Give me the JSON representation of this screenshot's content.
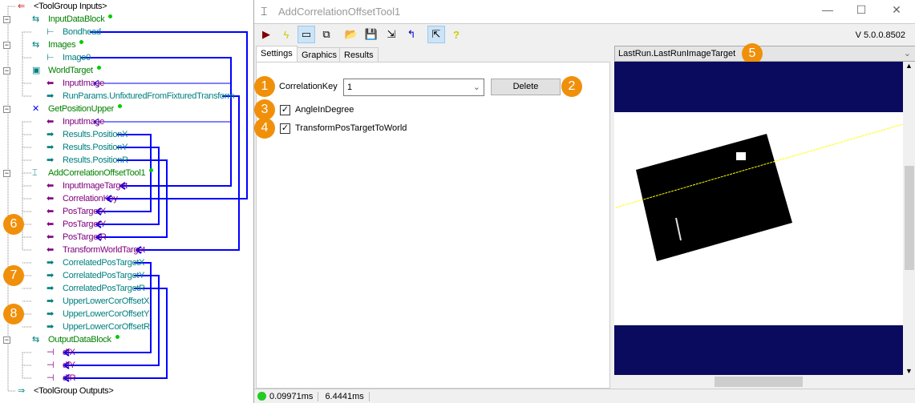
{
  "tree": {
    "rows": [
      {
        "label": "<ToolGroup Inputs>",
        "color": "black",
        "indent": 0,
        "icon": "toolgroup-inputs-icon"
      },
      {
        "label": "InputDataBlock",
        "color": "green",
        "indent": 1,
        "icon": "datablock-icon",
        "ok": true
      },
      {
        "label": "Bondhead",
        "color": "teal",
        "indent": 2,
        "icon": "output-terminal-icon"
      },
      {
        "label": "Images",
        "color": "green",
        "indent": 1,
        "icon": "datablock-icon",
        "ok": true
      },
      {
        "label": "Image0",
        "color": "teal",
        "indent": 2,
        "icon": "output-terminal-icon"
      },
      {
        "label": "WorldTarget",
        "color": "green",
        "indent": 1,
        "icon": "calib-tool-icon",
        "ok": true
      },
      {
        "label": "InputImage",
        "color": "purple",
        "indent": 2,
        "icon": "input-arrow-icon"
      },
      {
        "label": "RunParams.UnfixturedFromFixturedTransform",
        "color": "teal",
        "indent": 2,
        "icon": "output-arrow-icon"
      },
      {
        "label": "GetPositionUpper",
        "color": "green",
        "indent": 1,
        "icon": "position-tool-icon",
        "ok": true
      },
      {
        "label": "InputImage",
        "color": "purple",
        "indent": 2,
        "icon": "input-arrow-icon"
      },
      {
        "label": "Results.PositionX",
        "color": "teal",
        "indent": 2,
        "icon": "output-arrow-icon"
      },
      {
        "label": "Results.PositionY",
        "color": "teal",
        "indent": 2,
        "icon": "output-arrow-icon"
      },
      {
        "label": "Results.PositionR",
        "color": "teal",
        "indent": 2,
        "icon": "output-arrow-icon"
      },
      {
        "label": "AddCorrelationOffsetTool1",
        "color": "green",
        "indent": 1,
        "icon": "correlation-tool-icon",
        "ok": true
      },
      {
        "label": "InputImageTarget",
        "color": "purple",
        "indent": 2,
        "icon": "input-arrow-icon"
      },
      {
        "label": "CorrelationKey",
        "color": "purple",
        "indent": 2,
        "icon": "input-arrow-icon"
      },
      {
        "label": "PosTargetX",
        "color": "purple",
        "indent": 2,
        "icon": "input-arrow-icon"
      },
      {
        "label": "PosTargetY",
        "color": "purple",
        "indent": 2,
        "icon": "input-arrow-icon"
      },
      {
        "label": "PosTargetR",
        "color": "purple",
        "indent": 2,
        "icon": "input-arrow-icon"
      },
      {
        "label": "TransformWorldTarget",
        "color": "purple",
        "indent": 2,
        "icon": "input-arrow-icon"
      },
      {
        "label": "CorrelatedPosTargetX",
        "color": "teal",
        "indent": 2,
        "icon": "output-arrow-icon"
      },
      {
        "label": "CorrelatedPosTargetY",
        "color": "teal",
        "indent": 2,
        "icon": "output-arrow-icon"
      },
      {
        "label": "CorrelatedPosTargetR",
        "color": "teal",
        "indent": 2,
        "icon": "output-arrow-icon"
      },
      {
        "label": "UpperLowerCorOffsetX",
        "color": "teal",
        "indent": 2,
        "icon": "output-arrow-icon"
      },
      {
        "label": "UpperLowerCorOffsetY",
        "color": "teal",
        "indent": 2,
        "icon": "output-arrow-icon"
      },
      {
        "label": "UpperLowerCorOffsetR",
        "color": "teal",
        "indent": 2,
        "icon": "output-arrow-icon"
      },
      {
        "label": "OutputDataBlock",
        "color": "green",
        "indent": 1,
        "icon": "datablock-icon",
        "ok": true
      },
      {
        "label": "dfX",
        "color": "purple",
        "indent": 2,
        "icon": "input-terminal-icon"
      },
      {
        "label": "dfY",
        "color": "purple",
        "indent": 2,
        "icon": "input-terminal-icon"
      },
      {
        "label": "dfR",
        "color": "purple",
        "indent": 2,
        "icon": "input-terminal-icon"
      },
      {
        "label": "<ToolGroup Outputs>",
        "color": "black",
        "indent": 0,
        "icon": "toolgroup-outputs-icon"
      }
    ],
    "badges": [
      "6",
      "7",
      "8"
    ]
  },
  "window": {
    "title": "AddCorrelationOffsetTool1",
    "minimize": "—",
    "maximize": "☐",
    "close": "✕",
    "version": "V 5.0.0.8502",
    "toolbar": [
      "run-icon",
      "lightning-icon",
      "show-input-icon",
      "show-output-icon",
      "open-icon",
      "save-icon",
      "save-as-icon",
      "reset-icon",
      "graphics-icon",
      "help-icon"
    ],
    "tabs": [
      "Settings",
      "Graphics",
      "Results"
    ],
    "active_tab": "Settings",
    "settings": {
      "correlation_key_label": "CorrelationKey",
      "correlation_key_value": "1",
      "delete_label": "Delete",
      "angle_in_degree_label": "AngleInDegree",
      "angle_in_degree_checked": true,
      "transform_label": "TransformPosTargetToWorld",
      "transform_checked": true
    },
    "badges": [
      "1",
      "2",
      "3",
      "4",
      "5"
    ],
    "image_selector": "LastRun.LastRunImageTarget",
    "status": {
      "time1": "0.09971ms",
      "time2": "6.4441ms",
      "status_color": "#22cc22"
    }
  },
  "colors": {
    "link": "#0000ff",
    "badge": "#f0900a",
    "image_bg": "#0a0a5e"
  }
}
